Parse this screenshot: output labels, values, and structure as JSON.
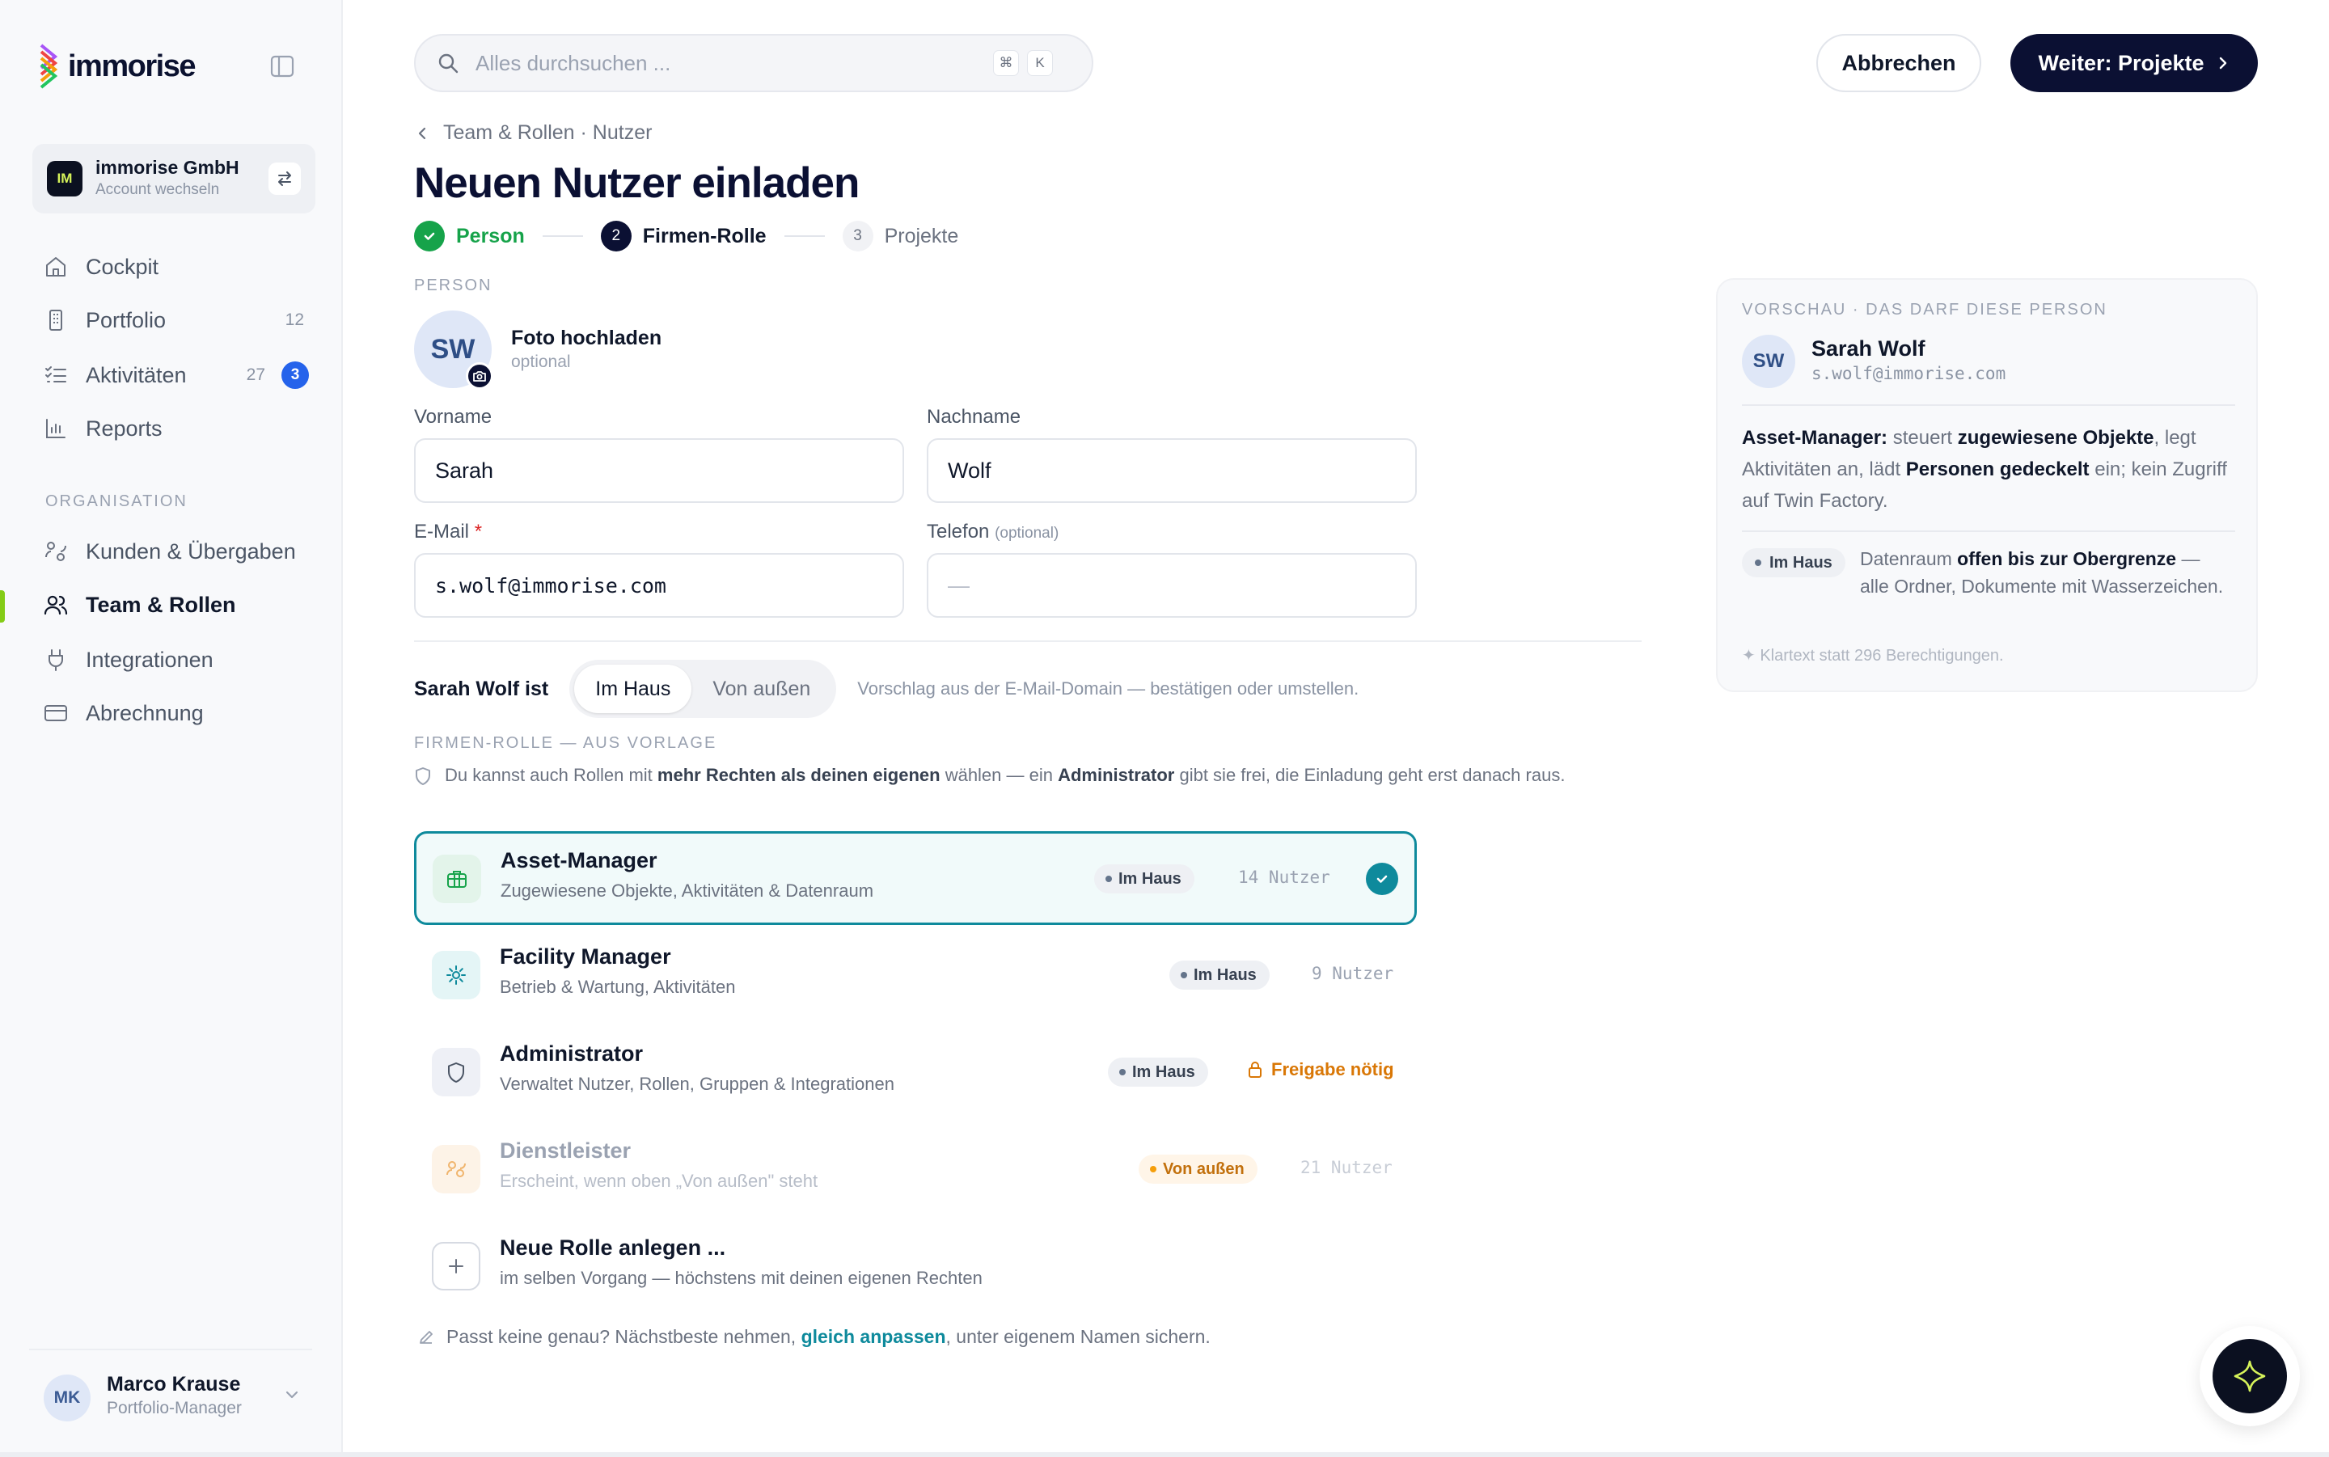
{
  "brand": {
    "name": "immorise",
    "colors": [
      "#a855f7",
      "#ef4444",
      "#f59e0b",
      "#22c55e",
      "#06b6d4"
    ]
  },
  "account": {
    "logo": "IM",
    "name": "immorise GmbH",
    "sub": "Account wechseln"
  },
  "sidebar": {
    "items": [
      {
        "label": "Cockpit",
        "icon": "home-icon"
      },
      {
        "label": "Portfolio",
        "icon": "building-icon",
        "count": "12"
      },
      {
        "label": "Aktivitäten",
        "icon": "checklist-icon",
        "count": "27",
        "badge": "3"
      },
      {
        "label": "Reports",
        "icon": "chart-icon"
      }
    ],
    "section": "ORGANISATION",
    "org_items": [
      {
        "label": "Kunden & Übergaben",
        "icon": "handshake-icon"
      },
      {
        "label": "Team & Rollen",
        "icon": "users-icon",
        "active": true
      },
      {
        "label": "Integrationen",
        "icon": "plug-icon"
      },
      {
        "label": "Abrechnung",
        "icon": "credit-card-icon"
      }
    ]
  },
  "user": {
    "initials": "MK",
    "name": "Marco Krause",
    "role": "Portfolio-Manager"
  },
  "search": {
    "placeholder": "Alles durchsuchen ...",
    "kbd1": "⌘",
    "kbd2": "K"
  },
  "actions": {
    "cancel": "Abbrechen",
    "next": "Weiter: Projekte"
  },
  "breadcrumb": "Team & Rollen · Nutzer",
  "title": "Neuen Nutzer einladen",
  "steps": [
    {
      "num": "1",
      "label": "Person",
      "state": "done"
    },
    {
      "num": "2",
      "label": "Firmen-Rolle",
      "state": "current"
    },
    {
      "num": "3",
      "label": "Projekte",
      "state": "todo"
    }
  ],
  "person": {
    "caption": "PERSON",
    "initials": "SW",
    "photo_title": "Foto hochladen",
    "photo_sub": "optional",
    "firstname_label": "Vorname",
    "firstname": "Sarah",
    "lastname_label": "Nachname",
    "lastname": "Wolf",
    "email_label": "E-Mail",
    "email_req": "*",
    "email": "s.wolf@immorise.com",
    "phone_label": "Telefon",
    "phone_opt": "(optional)",
    "phone_placeholder": "—"
  },
  "kind": {
    "label": "Sarah Wolf ist",
    "options": [
      "Im Haus",
      "Von außen"
    ],
    "selected": "Im Haus",
    "hint": "Vorschlag aus der E-Mail-Domain — bestätigen oder umstellen."
  },
  "roles_section": {
    "caption": "FIRMEN-ROLLE — AUS VORLAGE",
    "note_1": "Du kannst auch Rollen mit ",
    "note_b1": "mehr Rechten als deinen eigenen",
    "note_2": " wählen — ein ",
    "note_b2": "Administrator",
    "note_3": " gibt sie frei, die Einladung geht erst danach raus."
  },
  "roles": [
    {
      "title": "Asset-Manager",
      "desc": "Zugewiesene Objekte, Aktivitäten & Datenraum",
      "badge": "Im Haus",
      "users": "14 Nutzer",
      "selected": true
    },
    {
      "title": "Facility Manager",
      "desc": "Betrieb & Wartung, Aktivitäten",
      "badge": "Im Haus",
      "users": "9 Nutzer"
    },
    {
      "title": "Administrator",
      "desc": "Verwaltet Nutzer, Rollen, Gruppen & Integrationen",
      "badge": "Im Haus",
      "approval": "Freigabe nötig"
    },
    {
      "title": "Dienstleister",
      "desc": "Erscheint, wenn oben „Von außen\" steht",
      "badge": "Von außen",
      "users": "21 Nutzer",
      "disabled": true
    },
    {
      "title": "Neue Rolle anlegen ...",
      "desc": "im selben Vorgang — höchstens mit deinen eigenen Rechten"
    }
  ],
  "footer": {
    "text_1": "Passt keine genau? Nächstbeste nehmen,",
    "link": "gleich anpassen",
    "text_2": ", unter eigenem Namen sichern."
  },
  "preview": {
    "caption": "VORSCHAU · DAS DARF DIESE PERSON",
    "initials": "SW",
    "name": "Sarah Wolf",
    "email": "s.wolf@immorise.com",
    "desc_b1": "Asset-Manager:",
    "desc_1": " steuert ",
    "desc_b2": "zugewiesene Objekte",
    "desc_2": ", legt Aktivitäten an, lädt ",
    "desc_b3": "Personen gedeckelt",
    "desc_3": " ein; kein Zugriff auf Twin Factory.",
    "pill": "Im Haus",
    "room_1": "Datenraum ",
    "room_b": "offen bis zur Obergrenze",
    "room_2": " — alle Ordner, Dokumente mit Wasserzeichen.",
    "footer": "✦ Klartext statt 296 Berechtigungen."
  },
  "colors": {
    "accent": "#0e8a9c",
    "primary": "#0b1033",
    "success": "#16a34a",
    "warning": "#d97706",
    "nav_active": "#84cc16"
  }
}
